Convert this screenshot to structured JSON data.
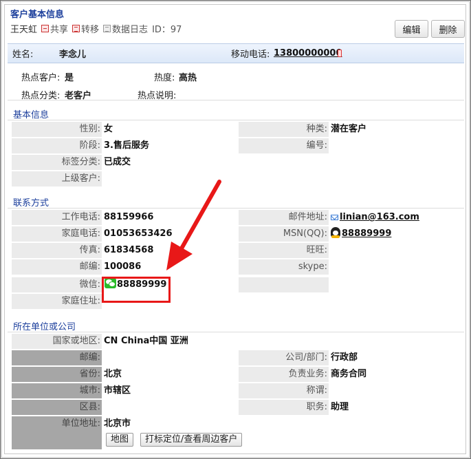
{
  "header": {
    "title": "客户基本信息",
    "owner": "王天虹",
    "actions": {
      "share": "共享",
      "transfer": "转移",
      "log": "数据日志"
    },
    "id_label": "ID：97",
    "edit_button": "编辑",
    "delete_button": "删除"
  },
  "namebar": {
    "name_label": "姓名:",
    "name_value": "李念儿",
    "mobile_label": "移动电话:",
    "mobile_value": "13800000000"
  },
  "hot": {
    "hot_customer_label": "热点客户:",
    "hot_customer_value": "是",
    "heat_label": "热度:",
    "heat_value": "高热",
    "hot_category_label": "热点分类:",
    "hot_category_value": "老客户",
    "hot_note_label": "热点说明:",
    "hot_note_value": ""
  },
  "basic": {
    "title": "基本信息",
    "gender_label": "性别:",
    "gender_value": "女",
    "type_label": "种类:",
    "type_value": "潜在客户",
    "stage_label": "阶段:",
    "stage_value": "3.售后服务",
    "number_label": "编号:",
    "number_value": "",
    "tag_label": "标签分类:",
    "tag_value": "已成交",
    "parent_label": "上级客户:",
    "parent_value": ""
  },
  "contact": {
    "title": "联系方式",
    "work_phone_label": "工作电话:",
    "work_phone_value": "88159966",
    "email_label": "邮件地址:",
    "email_value": "linian@163.com",
    "home_phone_label": "家庭电话:",
    "home_phone_value": "01053653426",
    "msn_label": "MSN(QQ):",
    "msn_value": "88889999",
    "fax_label": "传真:",
    "fax_value": "61834568",
    "wangwang_label": "旺旺:",
    "wangwang_value": "",
    "zip_label": "邮编:",
    "zip_value": "100086",
    "skype_label": "skype:",
    "skype_value": "",
    "wechat_label": "微信:",
    "wechat_value": "88889999",
    "home_address_label": "家庭住址:",
    "home_address_value": ""
  },
  "company": {
    "title": "所在单位或公司",
    "country_label": "国家或地区:",
    "country_value": "CN China中国 亚洲",
    "zip_label": "邮编:",
    "zip_value": "",
    "dept_label": "公司/部门:",
    "dept_value": "行政部",
    "province_label": "省份:",
    "province_value": "北京",
    "business_label": "负责业务:",
    "business_value": "商务合同",
    "city_label": "城市:",
    "city_value": "市辖区",
    "title_label": "称谓:",
    "title_value": "",
    "district_label": "区县:",
    "district_value": "",
    "position_label": "职务:",
    "position_value": "助理",
    "address_label": "单位地址:",
    "address_value": "北京市",
    "map_button": "地图",
    "locate_button": "打标定位/查看周边客户"
  },
  "colors": {
    "section_title": "#1c3f9c",
    "highlight": "#e81818",
    "namebar_bg": "#dce8f8"
  }
}
